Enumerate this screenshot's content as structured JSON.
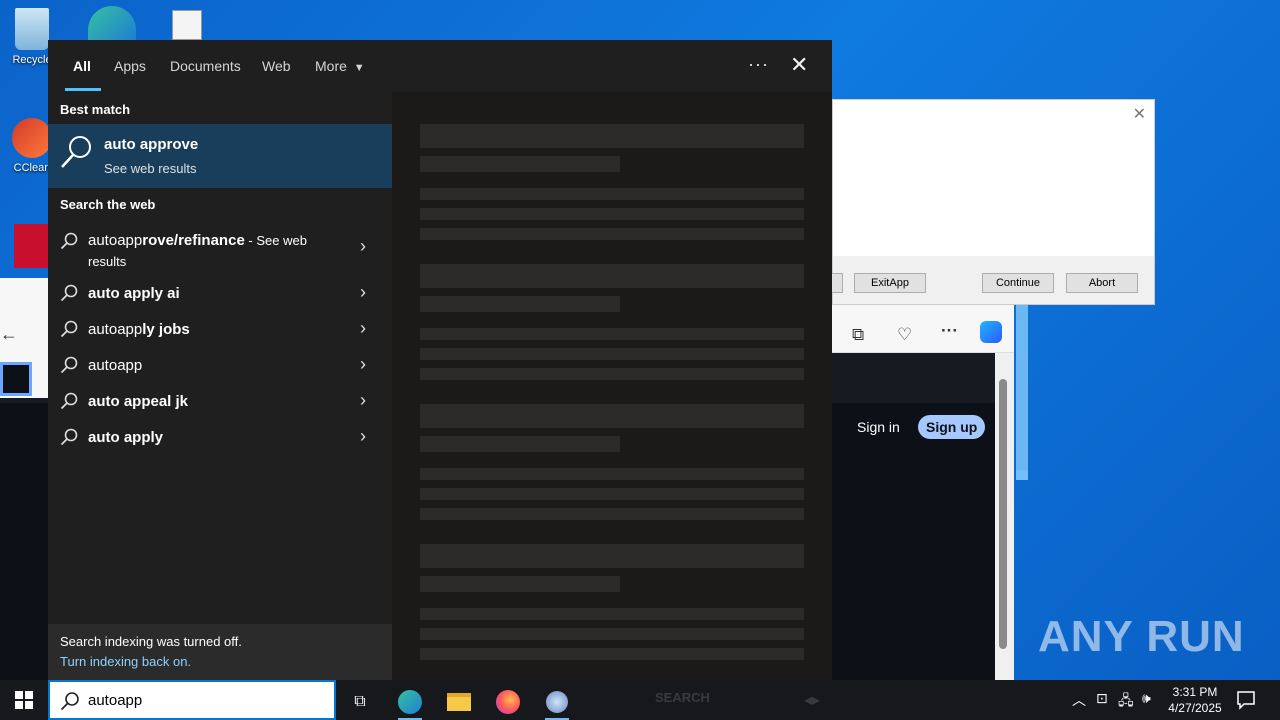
{
  "desktop": {
    "icons": [
      {
        "label": "Recycle",
        "icon": "recycle-bin-icon"
      },
      {
        "label": "CClean",
        "icon": "ccleaner-icon"
      }
    ]
  },
  "dialog": {
    "buttons": {
      "exit": "ExitApp",
      "continue": "Continue",
      "abort": "Abort"
    }
  },
  "browser": {
    "sign_in": "Sign in",
    "sign_up": "Sign up"
  },
  "search": {
    "tabs": [
      {
        "label": "All",
        "active": true
      },
      {
        "label": "Apps"
      },
      {
        "label": "Documents"
      },
      {
        "label": "Web"
      },
      {
        "label": "More"
      }
    ],
    "best_match_heading": "Best match",
    "best_match": {
      "title": "auto approve",
      "subtitle": "See web results"
    },
    "web_heading": "Search the web",
    "web_results": [
      {
        "prefix": "autoapp",
        "bold": "rove/refinance",
        "suffix_line1": " - See web",
        "suffix_line2": "results"
      },
      {
        "prefix": "",
        "bold": "auto apply ai"
      },
      {
        "prefix": "autoapp",
        "bold": "ly jobs"
      },
      {
        "prefix": "autoapp",
        "bold": ""
      },
      {
        "prefix": "",
        "bold": "auto appeal jk"
      },
      {
        "prefix": "",
        "bold": "auto apply"
      }
    ],
    "index_note": {
      "line1": "Search indexing was turned off.",
      "line2": "Turn indexing back on."
    }
  },
  "taskbar": {
    "search_value": "autoapp",
    "ghost_text": "SEARCH",
    "clock": {
      "time": "3:31 PM",
      "date": "4/27/2025"
    }
  },
  "watermark": "ANY RUN",
  "colors": {
    "accent": "#4cc2ff",
    "best_match_bg": "#193e5c",
    "panel_bg": "#1f1f1f",
    "link": "#8fd1ff"
  }
}
